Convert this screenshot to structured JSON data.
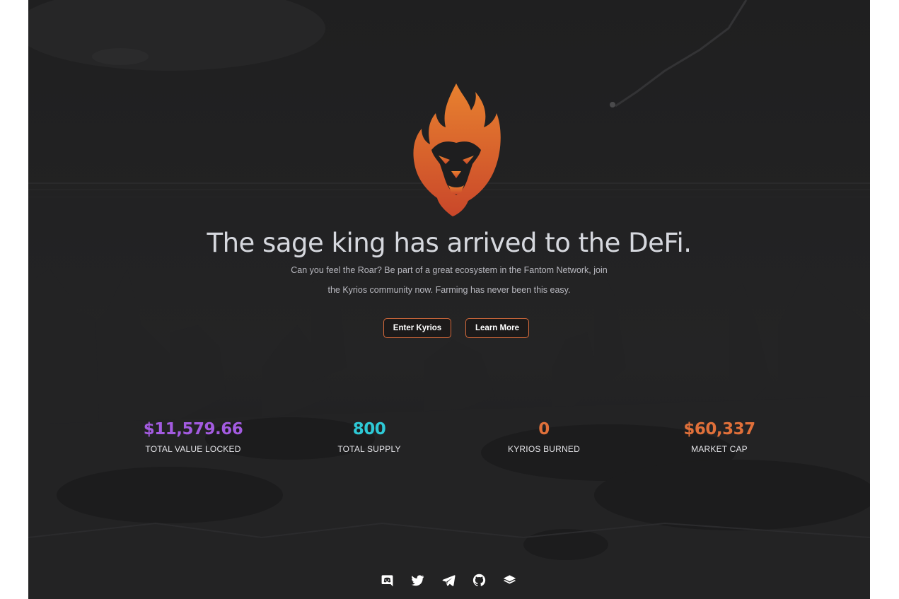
{
  "hero": {
    "headline": "The sage king has arrived to the DeFi.",
    "subtitle_line1": "Can you feel the Roar? Be part of a great ecosystem in the Fantom Network, join",
    "subtitle_line2": "the Kyrios community now. Farming has never been this easy."
  },
  "buttons": {
    "enter_label": "Enter Kyrios",
    "learn_label": "Learn More"
  },
  "stats": [
    {
      "value": "$11,579.66",
      "label": "TOTAL VALUE LOCKED",
      "color": "#a35be0"
    },
    {
      "value": "800",
      "label": "TOTAL SUPPLY",
      "color": "#2ec9d6"
    },
    {
      "value": "0",
      "label": "KYRIOS BURNED",
      "color": "#e0703a"
    },
    {
      "value": "$60,337",
      "label": "MARKET CAP",
      "color": "#e0703a"
    }
  ],
  "social": [
    "discord-icon",
    "twitter-icon",
    "telegram-icon",
    "github-icon",
    "docs-icon"
  ],
  "colors": {
    "background": "#1e1e1f",
    "accent": "#d66a3b",
    "flame_top": "#e8812f",
    "flame_bottom": "#c9472a"
  }
}
